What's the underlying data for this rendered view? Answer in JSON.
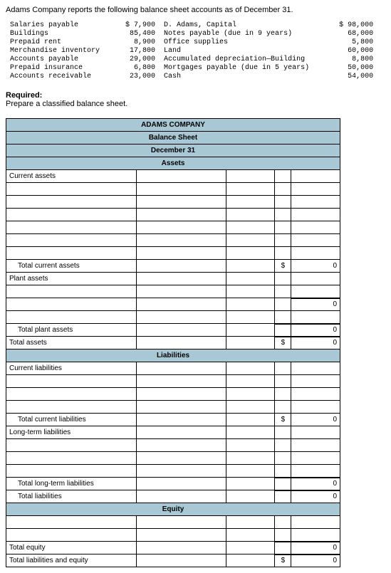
{
  "intro": "Adams Company reports the following balance sheet accounts as of December 31.",
  "accounts_block": " Salaries payable           $ 7,900  D. Adams, Capital                        $ 98,000\n Buildings                   85,400  Notes payable (due in 9 years)             68,000\n Prepaid rent                 8,900  Office supplies                             5,800\n Merchandise inventory       17,800  Land                                       60,000\n Accounts payable            29,000  Accumulated depreciation—Building           8,800\n Prepaid insurance            6,800  Mortgages payable (due in 5 years)         50,000\n Accounts receivable         23,000  Cash                                       54,000",
  "required_head": "Required:",
  "required_sub": "Prepare a classified balance sheet.",
  "sheet": {
    "company": "ADAMS COMPANY",
    "title": "Balance Sheet",
    "date": "December 31",
    "sections": {
      "assets": "Assets",
      "liabilities": "Liabilities",
      "equity": "Equity"
    },
    "rows": {
      "current_assets": "Current assets",
      "total_current_assets": "Total current assets",
      "plant_assets": "Plant assets",
      "total_plant_assets": "Total plant assets",
      "total_assets": "Total assets",
      "current_liabilities": "Current liabilities",
      "total_current_liabilities": "Total current liabilities",
      "long_term_liabilities": "Long-term liabilities",
      "total_long_term_liabilities": "Total long-term liabilities",
      "total_liabilities": "Total liabilities",
      "total_equity": "Total equity",
      "total_liab_equity": "Total liabilities and equity"
    },
    "currency": "$",
    "zero": "0"
  }
}
